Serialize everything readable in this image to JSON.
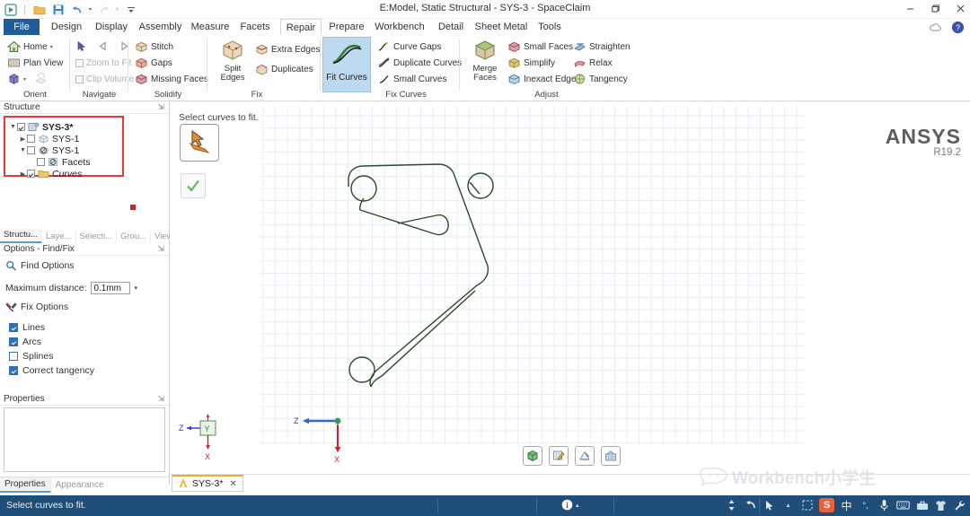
{
  "window": {
    "title": "E:Model, Static Structural - SYS-3 - SpaceClaim",
    "minimize": "–",
    "restore": "❐",
    "close": "✕"
  },
  "quick_access": {
    "run_label": "run-icon",
    "open_label": "open-icon",
    "save_label": "save-icon",
    "undo_label": "undo-icon",
    "redo_label": "redo-icon",
    "more_label": "▾"
  },
  "tabs": [
    {
      "label": "File",
      "active": false,
      "file": true
    },
    {
      "label": "Design",
      "active": false
    },
    {
      "label": "Display",
      "active": false
    },
    {
      "label": "Assembly",
      "active": false
    },
    {
      "label": "Measure",
      "active": false
    },
    {
      "label": "Facets",
      "active": false
    },
    {
      "label": "Repair",
      "active": true
    },
    {
      "label": "Prepare",
      "active": false
    },
    {
      "label": "Workbench",
      "active": false
    },
    {
      "label": "Detail",
      "active": false
    },
    {
      "label": "Sheet Metal",
      "active": false
    },
    {
      "label": "Tools",
      "active": false
    }
  ],
  "ribbon": {
    "groups": [
      {
        "name": "Orient",
        "label": "Orient"
      },
      {
        "name": "Navigate",
        "label": "Navigate"
      },
      {
        "name": "Solidify",
        "label": "Solidify"
      },
      {
        "name": "Fix",
        "label": "Fix"
      },
      {
        "name": "FixCurves",
        "label": "Fix Curves"
      },
      {
        "name": "Adjust",
        "label": "Adjust"
      }
    ],
    "orient": {
      "home": "Home",
      "home_caret": "▾",
      "plan_view": "Plan View",
      "box_caret": "▾"
    },
    "navigate": {
      "zoom_to_fit": "Zoom to Fit",
      "clip_volume": "Clip Volume"
    },
    "solidify": {
      "stitch": "Stitch",
      "gaps": "Gaps",
      "missing_faces": "Missing Faces"
    },
    "fix": {
      "split_edges": "Split\nEdges",
      "split_edges_l1": "Split",
      "split_edges_l2": "Edges",
      "extra_edges": "Extra Edges",
      "duplicates": "Duplicates"
    },
    "fit_curves": {
      "label": "Fit Curves",
      "active": true
    },
    "fix_curves": {
      "curve_gaps": "Curve Gaps",
      "duplicate_curves": "Duplicate Curves",
      "small_curves": "Small Curves"
    },
    "adjust": {
      "merge_faces_l1": "Merge",
      "merge_faces_l2": "Faces",
      "small_faces": "Small Faces",
      "simplify": "Simplify",
      "inexact_edges": "Inexact Edges",
      "straighten": "Straighten",
      "relax": "Relax",
      "tangency": "Tangency"
    }
  },
  "structure_panel": {
    "title": "Structure",
    "pin": "⇲",
    "tree": [
      {
        "label": "SYS-3*",
        "checked": true,
        "expander": "down",
        "indent": 0,
        "bold": true,
        "italic": false,
        "icon": "assembly-icon"
      },
      {
        "label": "SYS-1",
        "checked": false,
        "expander": "right",
        "indent": 1,
        "bold": false,
        "italic": false,
        "icon": "body-icon"
      },
      {
        "label": "SYS-1",
        "checked": false,
        "expander": "down",
        "indent": 1,
        "bold": false,
        "italic": false,
        "icon": "suppressed-body-icon"
      },
      {
        "label": "Facets",
        "checked": false,
        "expander": "none",
        "indent": 2,
        "bold": false,
        "italic": false,
        "icon": "facets-icon"
      },
      {
        "label": "Curves",
        "checked": true,
        "expander": "right",
        "indent": 1,
        "bold": false,
        "italic": true,
        "icon": "folder-icon"
      }
    ],
    "tabs": [
      {
        "label": "Structu...",
        "selected": true
      },
      {
        "label": "Laye...",
        "selected": false
      },
      {
        "label": "Selecti...",
        "selected": false
      },
      {
        "label": "Grou...",
        "selected": false
      },
      {
        "label": "Views",
        "selected": false
      }
    ]
  },
  "options_panel": {
    "title": "Options - Find/Fix",
    "pin": "⇲",
    "find_options": "Find Options",
    "max_distance_label": "Maximum distance:",
    "max_distance_value": "0.1mm",
    "dropdown_caret": "▾",
    "fix_options_title": "Fix Options",
    "fix_options": [
      {
        "label": "Lines",
        "checked": true
      },
      {
        "label": "Arcs",
        "checked": true
      },
      {
        "label": "Splines",
        "checked": false
      },
      {
        "label": "Correct tangency",
        "checked": true
      }
    ]
  },
  "properties_panel": {
    "title": "Properties",
    "pin": "⇲",
    "tabs": [
      {
        "label": "Properties",
        "selected": true
      },
      {
        "label": "Appearance",
        "selected": false
      }
    ]
  },
  "viewport": {
    "prompt": "Select curves to fit.",
    "select_tool": "select-curves-tool",
    "confirm_tool": "confirm-check-tool",
    "logo_name": "ANSYS",
    "logo_version": "R19.2",
    "axis_triad": {
      "x": "X",
      "y": "Y",
      "z": "Z"
    },
    "origin_axis": {
      "x": "X",
      "z": "Z"
    },
    "bottom_buttons": [
      {
        "name": "solid-view-button",
        "glyph": "box"
      },
      {
        "name": "sketch-mode-button",
        "glyph": "pencil"
      },
      {
        "name": "section-mode-button",
        "glyph": "section"
      },
      {
        "name": "display-mode-button",
        "glyph": "grid"
      }
    ]
  },
  "document_tab": {
    "label": "SYS-3*",
    "close": "✕"
  },
  "watermark": {
    "text": "Workbench小学生"
  },
  "statusbar": {
    "message": "Select curves to fit.",
    "info_glyph": "ℹ",
    "info_caret": "▴",
    "tray": [
      {
        "name": "resize-handle-icon",
        "glyph": "↕"
      },
      {
        "name": "rotate-icon",
        "glyph": "↺"
      },
      {
        "name": "cursor-icon",
        "glyph": "➤"
      },
      {
        "name": "cursor-caret-icon",
        "glyph": "▴"
      },
      {
        "name": "select-box-icon",
        "glyph": "⬚"
      },
      {
        "name": "sogou-ime-icon",
        "glyph": "S"
      },
      {
        "name": "chinese-mode-icon",
        "glyph": "中"
      },
      {
        "name": "punctuation-icon",
        "glyph": "°,"
      },
      {
        "name": "microphone-icon",
        "glyph": "🎙"
      },
      {
        "name": "keyboard-icon",
        "glyph": "⌨"
      },
      {
        "name": "toolbox-icon",
        "glyph": "⚒"
      },
      {
        "name": "skin-icon",
        "glyph": "👕"
      },
      {
        "name": "settings-wrench-icon",
        "glyph": "🔧"
      }
    ]
  },
  "colors": {
    "accent": "#1f5c99",
    "statusbar": "#1f4e79",
    "highlight": "#bcd9ef",
    "tree_border": "#e53935",
    "geometry": "#2c4a2c",
    "grid": "#e9eef4"
  }
}
